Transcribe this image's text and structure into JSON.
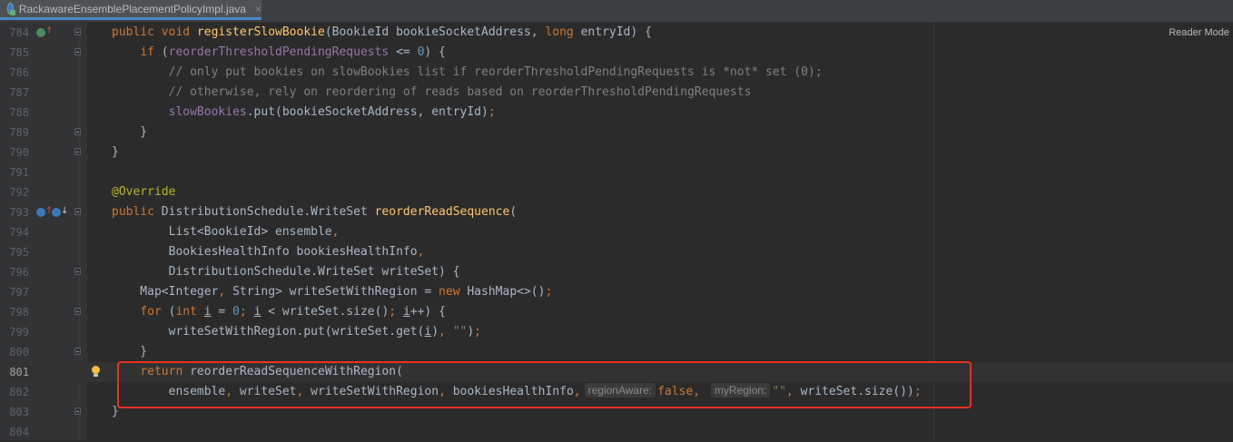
{
  "tab": {
    "title": "RackawareEnsemblePlacementPolicyImpl.java",
    "close": "×"
  },
  "reader_mode": "Reader Mode",
  "lines": [
    {
      "num": "784",
      "segs": [
        {
          "t": "public void ",
          "c": "kw"
        },
        {
          "t": "registerSlowBookie",
          "c": "fn"
        },
        {
          "t": "(BookieId bookieSocketAddress, ",
          "c": ""
        },
        {
          "t": "long ",
          "c": "kw"
        },
        {
          "t": "entryId) {",
          "c": ""
        }
      ]
    },
    {
      "num": "785",
      "segs": [
        {
          "t": "    ",
          "c": ""
        },
        {
          "t": "if ",
          "c": "kw"
        },
        {
          "t": "(",
          "c": ""
        },
        {
          "t": "reorderThresholdPendingRequests",
          "c": "fld"
        },
        {
          "t": " <= ",
          "c": ""
        },
        {
          "t": "0",
          "c": "num"
        },
        {
          "t": ") {",
          "c": ""
        }
      ]
    },
    {
      "num": "786",
      "segs": [
        {
          "t": "        // only put bookies on slowBookies list if reorderThresholdPendingRequests is *not* set (0);",
          "c": "cmt"
        }
      ]
    },
    {
      "num": "787",
      "segs": [
        {
          "t": "        // otherwise, rely on reordering of reads based on reorderThresholdPendingRequests",
          "c": "cmt"
        }
      ]
    },
    {
      "num": "788",
      "segs": [
        {
          "t": "        ",
          "c": ""
        },
        {
          "t": "slowBookies",
          "c": "fld"
        },
        {
          "t": ".put(bookieSocketAddress, entryId)",
          "c": ""
        },
        {
          "t": ";",
          "c": "kw"
        }
      ]
    },
    {
      "num": "789",
      "segs": [
        {
          "t": "    }",
          "c": ""
        }
      ]
    },
    {
      "num": "790",
      "segs": [
        {
          "t": "}",
          "c": ""
        }
      ]
    },
    {
      "num": "791",
      "segs": []
    },
    {
      "num": "792",
      "segs": [
        {
          "t": "@Override",
          "c": "ann"
        }
      ]
    },
    {
      "num": "793",
      "segs": [
        {
          "t": "public ",
          "c": "kw"
        },
        {
          "t": "DistributionSchedule.WriteSet ",
          "c": ""
        },
        {
          "t": "reorderReadSequence",
          "c": "fn"
        },
        {
          "t": "(",
          "c": ""
        }
      ]
    },
    {
      "num": "794",
      "segs": [
        {
          "t": "        List<BookieId> ensemble",
          "c": ""
        },
        {
          "t": ",",
          "c": "kw"
        }
      ]
    },
    {
      "num": "795",
      "segs": [
        {
          "t": "        BookiesHealthInfo bookiesHealthInfo",
          "c": ""
        },
        {
          "t": ",",
          "c": "kw"
        }
      ]
    },
    {
      "num": "796",
      "segs": [
        {
          "t": "        DistributionSchedule.WriteSet writeSet) {",
          "c": ""
        }
      ]
    },
    {
      "num": "797",
      "segs": [
        {
          "t": "    Map<Integer",
          "c": ""
        },
        {
          "t": ", ",
          "c": "kw"
        },
        {
          "t": "String> writeSetWithRegion = ",
          "c": ""
        },
        {
          "t": "new ",
          "c": "kw"
        },
        {
          "t": "HashMap<>()",
          "c": ""
        },
        {
          "t": ";",
          "c": "kw"
        }
      ]
    },
    {
      "num": "798",
      "segs": [
        {
          "t": "    ",
          "c": ""
        },
        {
          "t": "for ",
          "c": "kw"
        },
        {
          "t": "(",
          "c": ""
        },
        {
          "t": "int ",
          "c": "kw"
        },
        {
          "t": "i",
          "c": "ul"
        },
        {
          "t": " = ",
          "c": ""
        },
        {
          "t": "0",
          "c": "num"
        },
        {
          "t": "; ",
          "c": "kw"
        },
        {
          "t": "i",
          "c": "ul"
        },
        {
          "t": " < writeSet.size()",
          "c": ""
        },
        {
          "t": "; ",
          "c": "kw"
        },
        {
          "t": "i",
          "c": "ul"
        },
        {
          "t": "++) {",
          "c": ""
        }
      ]
    },
    {
      "num": "799",
      "segs": [
        {
          "t": "        writeSetWithRegion.put(writeSet.get(",
          "c": ""
        },
        {
          "t": "i",
          "c": "ul"
        },
        {
          "t": ")",
          "c": ""
        },
        {
          "t": ", ",
          "c": "kw"
        },
        {
          "t": "\"\"",
          "c": "str"
        },
        {
          "t": ")",
          "c": ""
        },
        {
          "t": ";",
          "c": "kw"
        }
      ]
    },
    {
      "num": "800",
      "segs": [
        {
          "t": "    }",
          "c": ""
        }
      ]
    },
    {
      "num": "801",
      "segs": [
        {
          "t": "    ",
          "c": ""
        },
        {
          "t": "return ",
          "c": "kw"
        },
        {
          "t": "reorderReadSequenceWithRegion(",
          "c": ""
        }
      ]
    },
    {
      "num": "802",
      "segs": [
        {
          "t": "        ensemble",
          "c": ""
        },
        {
          "t": ", ",
          "c": "kw"
        },
        {
          "t": "writeSet",
          "c": ""
        },
        {
          "t": ", ",
          "c": "kw"
        },
        {
          "t": "writeSetWithRegion",
          "c": ""
        },
        {
          "t": ", ",
          "c": "kw"
        },
        {
          "t": "bookiesHealthInfo",
          "c": ""
        },
        {
          "t": ",",
          "c": "kw"
        },
        {
          "t": "regionAware:",
          "c": "hint"
        },
        {
          "t": "false",
          "c": "kw"
        },
        {
          "t": ", ",
          "c": "kw"
        },
        {
          "t": "myRegion:",
          "c": "hint"
        },
        {
          "t": "\"\"",
          "c": "str"
        },
        {
          "t": ", ",
          "c": "kw"
        },
        {
          "t": "writeSet.size())",
          "c": ""
        },
        {
          "t": ";",
          "c": "kw"
        }
      ]
    },
    {
      "num": "803",
      "segs": [
        {
          "t": "}",
          "c": ""
        }
      ]
    },
    {
      "num": "804",
      "segs": []
    }
  ]
}
